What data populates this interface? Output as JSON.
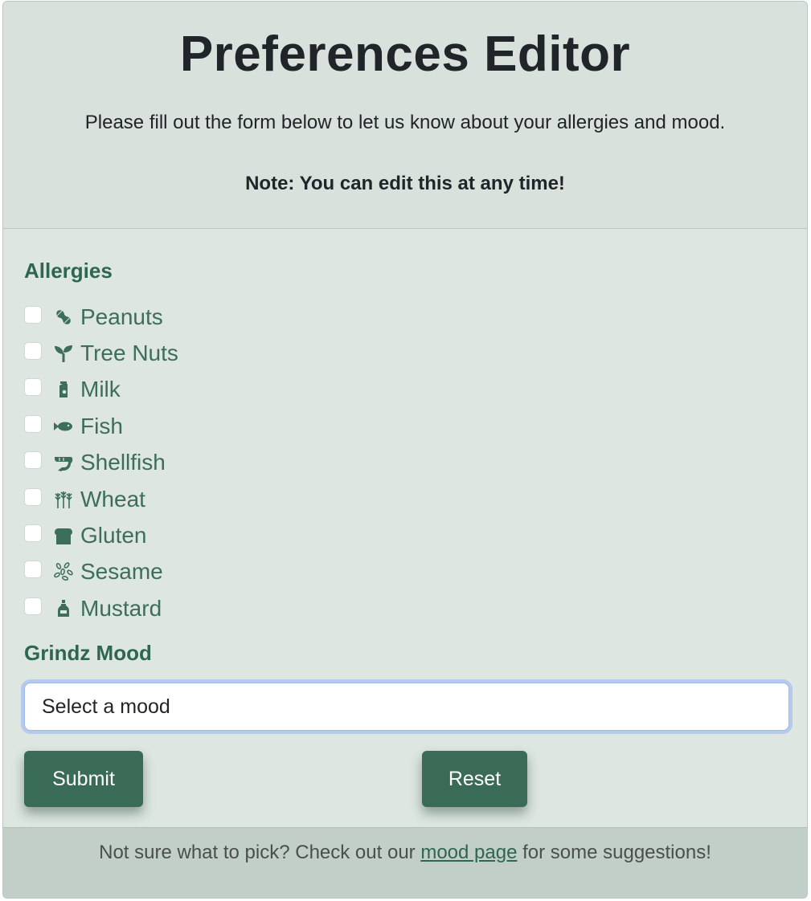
{
  "header": {
    "title": "Preferences Editor",
    "intro": "Please fill out the form below to let us know about your allergies and mood.",
    "note": "Note: You can edit this at any time!"
  },
  "allergies": {
    "label": "Allergies",
    "items": [
      {
        "label": "Peanuts",
        "icon": "peanut-icon",
        "checked": false
      },
      {
        "label": "Tree Nuts",
        "icon": "seedling-icon",
        "checked": false
      },
      {
        "label": "Milk",
        "icon": "milk-carton-icon",
        "checked": false
      },
      {
        "label": "Fish",
        "icon": "fish-icon",
        "checked": false
      },
      {
        "label": "Shellfish",
        "icon": "shrimp-icon",
        "checked": false
      },
      {
        "label": "Wheat",
        "icon": "wheat-icon",
        "checked": false
      },
      {
        "label": "Gluten",
        "icon": "bread-icon",
        "checked": false
      },
      {
        "label": "Sesame",
        "icon": "seeds-icon",
        "checked": false
      },
      {
        "label": "Mustard",
        "icon": "bottle-icon",
        "checked": false
      }
    ]
  },
  "mood": {
    "label": "Grindz Mood",
    "selected": "Select a mood"
  },
  "actions": {
    "submit_label": "Submit",
    "reset_label": "Reset"
  },
  "footer": {
    "prefix": "Not sure what to pick? Check out our ",
    "link_text": "mood page",
    "suffix": " for some suggestions!"
  },
  "colors": {
    "accent": "#3a6b57",
    "label_green": "#2e6650",
    "card_bg": "#dde6e1",
    "footer_bg": "#c2cfc9",
    "focus_ring": "#b6c9ee"
  }
}
